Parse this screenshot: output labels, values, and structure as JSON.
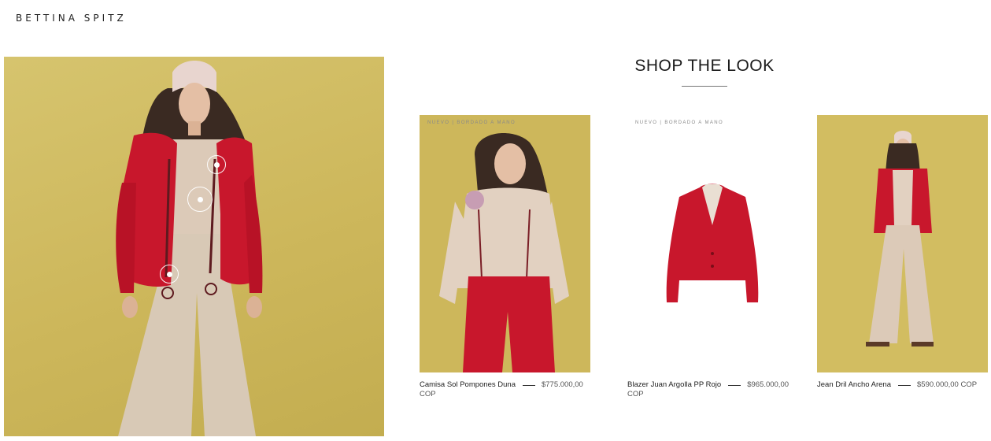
{
  "header": {
    "logo_text": "BETTINA SPITZ"
  },
  "hero": {
    "image_alt": "Model wearing red blazer, beige blouse and wide beige trousers",
    "hotspots": [
      "product-hotspot",
      "product-hotspot",
      "product-hotspot"
    ]
  },
  "shop_the_look": {
    "title": "SHOP THE LOOK",
    "products": [
      {
        "badge": "NUEVO | BORDADO A MANO",
        "name": "Camisa Sol Pompones Duna",
        "price_main": "$775.000,00",
        "price_cont": "COP"
      },
      {
        "badge": "NUEVO | BORDADO A MANO",
        "name": "Blazer Juan Argolla PP Rojo",
        "price_main": "$965.000,00",
        "price_cont": "COP"
      },
      {
        "badge": "",
        "name": "Jean Dril Ancho Arena",
        "price_main": "$590.000,00 COP",
        "price_cont": ""
      }
    ]
  },
  "colors": {
    "mustard": "#cdb75b",
    "red": "#c8172c",
    "beige": "#d8c9b6",
    "white": "#ffffff"
  }
}
